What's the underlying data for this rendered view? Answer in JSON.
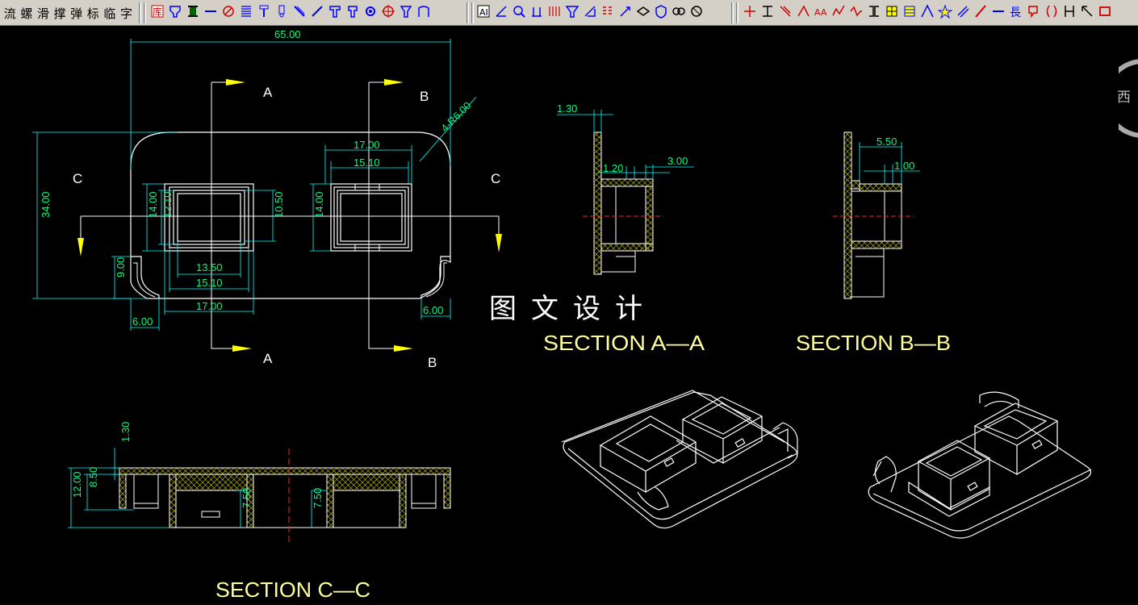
{
  "toolbar": {
    "char_buttons": [
      "流",
      "螺",
      "滑",
      "撑",
      "弹",
      "标",
      "临",
      "字"
    ],
    "group1_icons": [
      "library-icon",
      "fitting-icon",
      "column-icon",
      "line-icon",
      "circle-x-icon",
      "spring-icon",
      "screw-icon",
      "bolt-icon",
      "pin-icon",
      "slash-icon",
      "tee-icon",
      "punch-icon",
      "gear-icon",
      "target-icon",
      "ejector-icon",
      "gate-icon"
    ],
    "group2_icons": [
      "text-icon",
      "angle-icon",
      "zoom-icon",
      "height-icon",
      "grid-icon",
      "funnel-icon",
      "scale-icon",
      "pattern-icon",
      "arrow-icon",
      "layer-icon",
      "shield-icon",
      "link-icon",
      "filter-icon"
    ],
    "group3_icons": [
      "cross-icon",
      "section-icon",
      "diagonal-icon",
      "angle-dim-icon",
      "aa-icon",
      "chart-icon",
      "zigzag-icon",
      "bracket-icon",
      "hatch-icon",
      "table-icon",
      "peak-icon",
      "star-icon",
      "parallel-icon",
      "slant-icon",
      "line-icon",
      "length-icon",
      "balloon-icon",
      "paren-icon",
      "column-mark-icon",
      "corner-icon",
      "rect-icon"
    ],
    "length_label": "長"
  },
  "drawing": {
    "title": "图文设计",
    "section_aa": "SECTION A—A",
    "section_bb": "SECTION B—B",
    "section_cc": "SECTION C—C",
    "side_text": "西",
    "labels": {
      "a_top": "A",
      "a_bot": "A",
      "b_top": "B",
      "b_bot": "B",
      "c_left": "C",
      "c_right": "C"
    },
    "dims": {
      "w65": "65.00",
      "r6": "4-R6.00",
      "h34": "34.00",
      "w17_right": "17.00",
      "w1510_right": "15.10",
      "h14_right": "14.00",
      "h14_left": "14.00",
      "h1210": "12.10",
      "h1050": "10.50",
      "w1350": "13.50",
      "w1510_left": "15.10",
      "w17_left": "17.00",
      "h9": "9.00",
      "w6_left": "6.00",
      "w6_right": "6.00",
      "aa_130": "1.30",
      "aa_120": "1.20",
      "aa_300": "3.00",
      "bb_550": "5.50",
      "bb_100": "1.00",
      "cc_130": "1.30",
      "cc_1200": "12.00",
      "cc_850": "8.50",
      "cc_750a": "7.50",
      "cc_750b": "7.50"
    }
  },
  "colors": {
    "background": "#000000",
    "dim": "#00ff7f",
    "dimline": "#00ffff",
    "outline": "#ffffff",
    "arrow": "#ffff00",
    "hatch": "#ffff00",
    "center": "#ff2020",
    "label": "#ffff99"
  }
}
